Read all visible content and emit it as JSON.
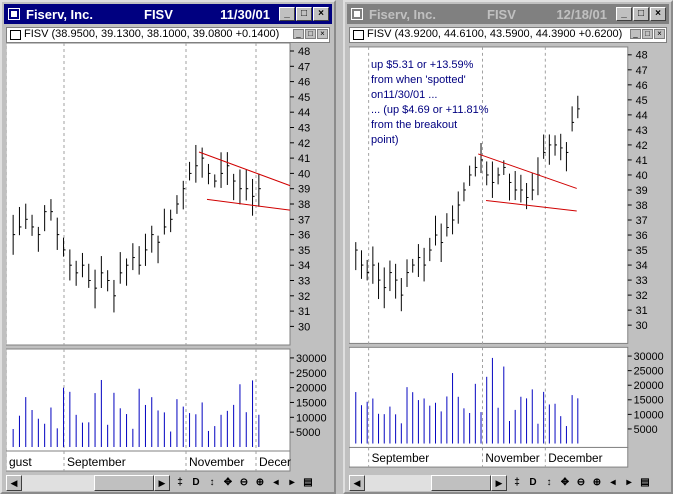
{
  "windows": [
    {
      "title_company": "Fiserv, Inc.",
      "title_symbol": "FISV",
      "title_date": "11/30/01",
      "quote_line": "FISV (38.9500, 39.1300, 38.1000, 39.0800 +0.1400)",
      "xaxis": [
        "gust",
        "September",
        "November",
        "Decer"
      ],
      "annotation": []
    },
    {
      "title_company": "Fiserv, Inc.",
      "title_symbol": "FISV",
      "title_date": "12/18/01",
      "quote_line": "FISV (43.9200, 44.6100, 43.5900, 44.3900 +0.6200)",
      "xaxis": [
        "September",
        "November",
        "December"
      ],
      "annotation": [
        "up $5.31 or +13.59%",
        "from when 'spotted'",
        "on11/30/01 ...",
        "... (up $4.69 or +11.81%",
        "from the breakout",
        "point)"
      ]
    }
  ],
  "price_axis": [
    "48",
    "47",
    "46",
    "45",
    "44",
    "43",
    "42",
    "41",
    "40",
    "39",
    "38",
    "37",
    "36",
    "35",
    "34",
    "33",
    "32",
    "31",
    "30"
  ],
  "volume_axis": [
    "30000",
    "25000",
    "20000",
    "15000",
    "10000",
    "5000"
  ],
  "toolbar_glyphs": [
    "‡",
    "D",
    "↕",
    "✥",
    "⊖",
    "⊕",
    "◂",
    "▸",
    "▤"
  ],
  "colors": {
    "active_title": "#000080",
    "inactive_title": "#808080",
    "bars": "#000000",
    "volume": "#0000c0",
    "trendline": "#d00000",
    "annotation": "#000080"
  }
}
